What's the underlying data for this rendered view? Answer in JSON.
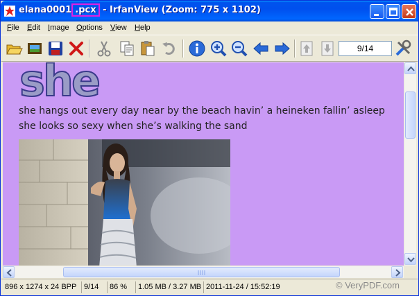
{
  "window": {
    "title_prefix": "elana0001",
    "title_ext": ".pcx",
    "title_suffix": " - IrfanView (Zoom: 775 x 1102)"
  },
  "menu": [
    "File",
    "Edit",
    "Image",
    "Options",
    "View",
    "Help"
  ],
  "toolbar": {
    "icons": [
      "open-folder-icon",
      "slideshow-icon",
      "save-icon",
      "delete-icon",
      "cut-icon",
      "copy-icon",
      "paste-icon",
      "undo-icon",
      "info-icon",
      "zoom-in-icon",
      "zoom-out-icon",
      "previous-icon",
      "next-icon",
      "page-up-icon",
      "page-down-icon",
      "properties-icon"
    ],
    "page_value": "9/14"
  },
  "image": {
    "heading": "she",
    "line1": "she hangs out every day near by the beach havin’ a heineken fallin’ asleep",
    "line2": "she looks so sexy when she’s walking the sand"
  },
  "status": {
    "dimensions": "896 x 1274 x 24 BPP",
    "page": "9/14",
    "zoom": "86 %",
    "size": "1.05 MB / 3.27 MB",
    "datetime": "2011-11-24 / 15:52:19"
  },
  "watermark": "© VeryPDF.com",
  "colors": {
    "canvas": "#c99af5",
    "titlebar": "#0054e3",
    "highlight": "#e020e0"
  },
  "scroll": {
    "vertical_position": 0.18,
    "horizontal_position": 0.17
  }
}
